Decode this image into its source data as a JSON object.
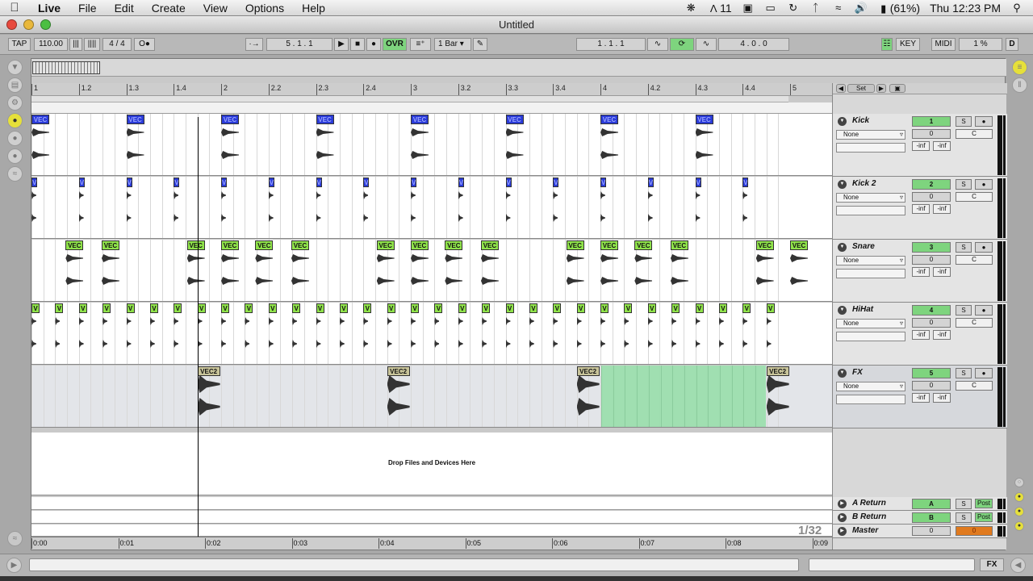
{
  "menubar": {
    "app": "Live",
    "items": [
      "File",
      "Edit",
      "Create",
      "View",
      "Options",
      "Help"
    ],
    "status": {
      "adobe": "11",
      "battery": "(61%)",
      "clock": "Thu 12:23 PM"
    }
  },
  "window": {
    "title": "Untitled"
  },
  "toolbar": {
    "tap": "TAP",
    "tempo": "110.00",
    "nudge_down": "|||",
    "nudge_up": "||||",
    "signature": "4 / 4",
    "metro": "O●",
    "follow": "·→",
    "arrangement_position": "5 . 1 . 1",
    "ovr": "OVR",
    "quantize": "1 Bar",
    "loop_start": "1 . 1 . 1",
    "loop_length": "4 . 0 . 0",
    "key": "KEY",
    "midi": "MIDI",
    "cpu": "1 %",
    "disk": "D"
  },
  "ruler": {
    "bars": [
      "1",
      "1.2",
      "1.3",
      "1.4",
      "2",
      "2.2",
      "2.3",
      "2.4",
      "3",
      "3.2",
      "3.3",
      "3.4",
      "4",
      "4.2",
      "4.3",
      "4.4",
      "5"
    ]
  },
  "timeline": {
    "seconds": [
      "0:00",
      "0:01",
      "0:02",
      "0:03",
      "0:04",
      "0:05",
      "0:06",
      "0:07",
      "0:08",
      "0:09"
    ],
    "zoom": "1/32"
  },
  "drop_zone": "Drop Files and Devices Here",
  "set_label": "Set",
  "tracks": [
    {
      "name": "Kick",
      "number": "1",
      "clip": "VEC",
      "input": "None",
      "volume": "0",
      "pan": "C",
      "solo": "S",
      "inf_l": "-inf",
      "inf_r": "-inf"
    },
    {
      "name": "Kick 2",
      "number": "2",
      "clip": "V",
      "input": "None",
      "volume": "0",
      "pan": "C",
      "solo": "S",
      "inf_l": "-inf",
      "inf_r": "-inf"
    },
    {
      "name": "Snare",
      "number": "3",
      "clip": "VEC",
      "input": "None",
      "volume": "0",
      "pan": "C",
      "solo": "S",
      "inf_l": "-inf",
      "inf_r": "-inf"
    },
    {
      "name": "HiHat",
      "number": "4",
      "clip": "V",
      "input": "None",
      "volume": "0",
      "pan": "C",
      "solo": "S",
      "inf_l": "-inf",
      "inf_r": "-inf"
    },
    {
      "name": "FX",
      "number": "5",
      "clip": "VEC2",
      "input": "None",
      "volume": "0",
      "pan": "C",
      "solo": "S",
      "inf_l": "-inf",
      "inf_r": "-inf"
    }
  ],
  "returns": [
    {
      "name": "A Return",
      "letter": "A",
      "solo": "S",
      "post": "Post"
    },
    {
      "name": "B Return",
      "letter": "B",
      "solo": "S",
      "post": "Post"
    }
  ],
  "master": {
    "name": "Master",
    "volume": "0",
    "pan": "0"
  },
  "bottom": {
    "fx": "FX"
  },
  "colors": {
    "clip_blue": "#2a3bd8",
    "clip_green": "#8fe24a",
    "clip_tan": "#c8c49a",
    "track_active": "#7ed47e",
    "selection": "#95dea8",
    "master_pan": "#e07a1e"
  }
}
